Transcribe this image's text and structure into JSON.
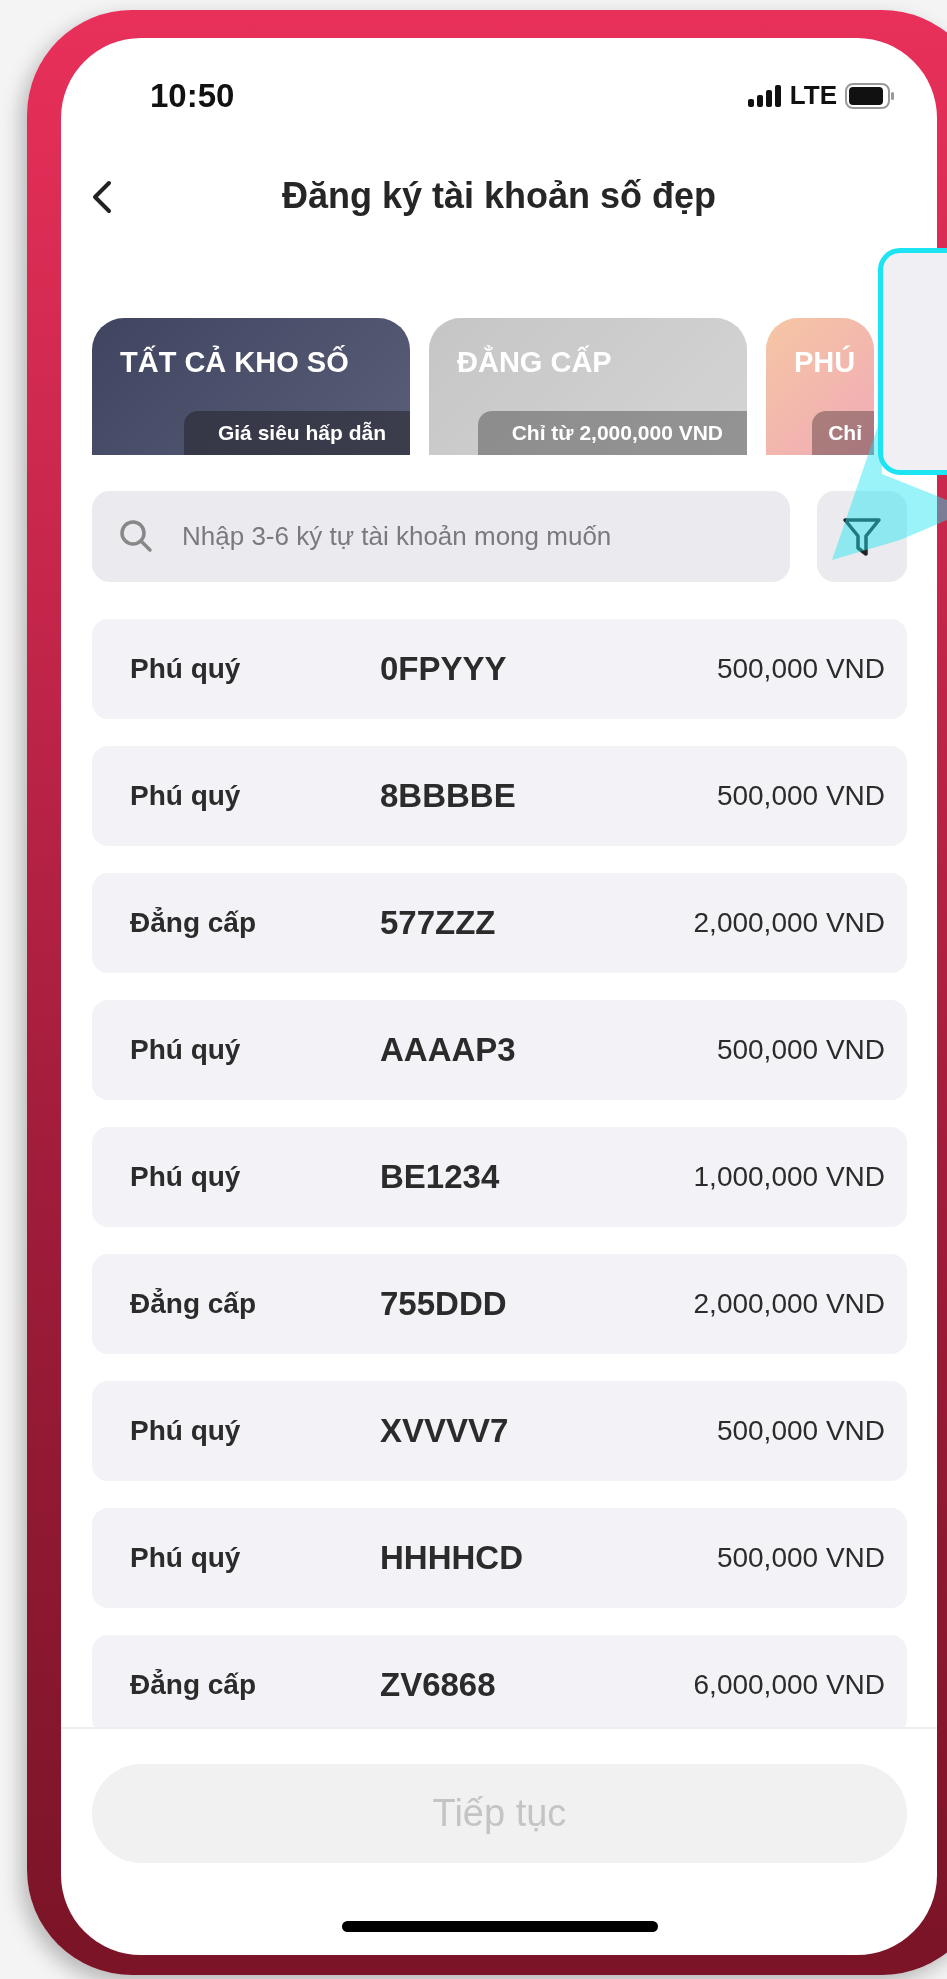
{
  "status_bar": {
    "time": "10:50",
    "network": "LTE"
  },
  "header": {
    "title": "Đăng ký tài khoản số đẹp"
  },
  "tabs": [
    {
      "title": "TẤT CẢ KHO SỐ",
      "subtitle": "Giá siêu hấp dẫn",
      "selected": true,
      "kind": "all"
    },
    {
      "title": "ĐẲNG CẤP",
      "subtitle": "Chỉ từ 2,000,000 VND",
      "selected": false,
      "kind": "premium"
    },
    {
      "title": "PHÚ",
      "subtitle": "Chỉ",
      "selected": false,
      "kind": "wealth"
    }
  ],
  "search": {
    "placeholder": "Nhập 3-6 ký tự tài khoản mong muốn"
  },
  "accounts": [
    {
      "category": "Phú quý",
      "number": "0FPYYY",
      "price": "500,000 VND"
    },
    {
      "category": "Phú quý",
      "number": "8BBBBE",
      "price": "500,000 VND"
    },
    {
      "category": "Đẳng cấp",
      "number": "577ZZZ",
      "price": "2,000,000 VND"
    },
    {
      "category": "Phú quý",
      "number": "AAAAP3",
      "price": "500,000 VND"
    },
    {
      "category": "Phú quý",
      "number": "BE1234",
      "price": "1,000,000 VND"
    },
    {
      "category": "Đẳng cấp",
      "number": "755DDD",
      "price": "2,000,000 VND"
    },
    {
      "category": "Phú quý",
      "number": "XVVVV7",
      "price": "500,000 VND"
    },
    {
      "category": "Phú quý",
      "number": "HHHHCD",
      "price": "500,000 VND"
    },
    {
      "category": "Đẳng cấp",
      "number": "ZV6868",
      "price": "6,000,000 VND"
    }
  ],
  "continue_button": {
    "label": "Tiếp tục",
    "disabled": true
  }
}
